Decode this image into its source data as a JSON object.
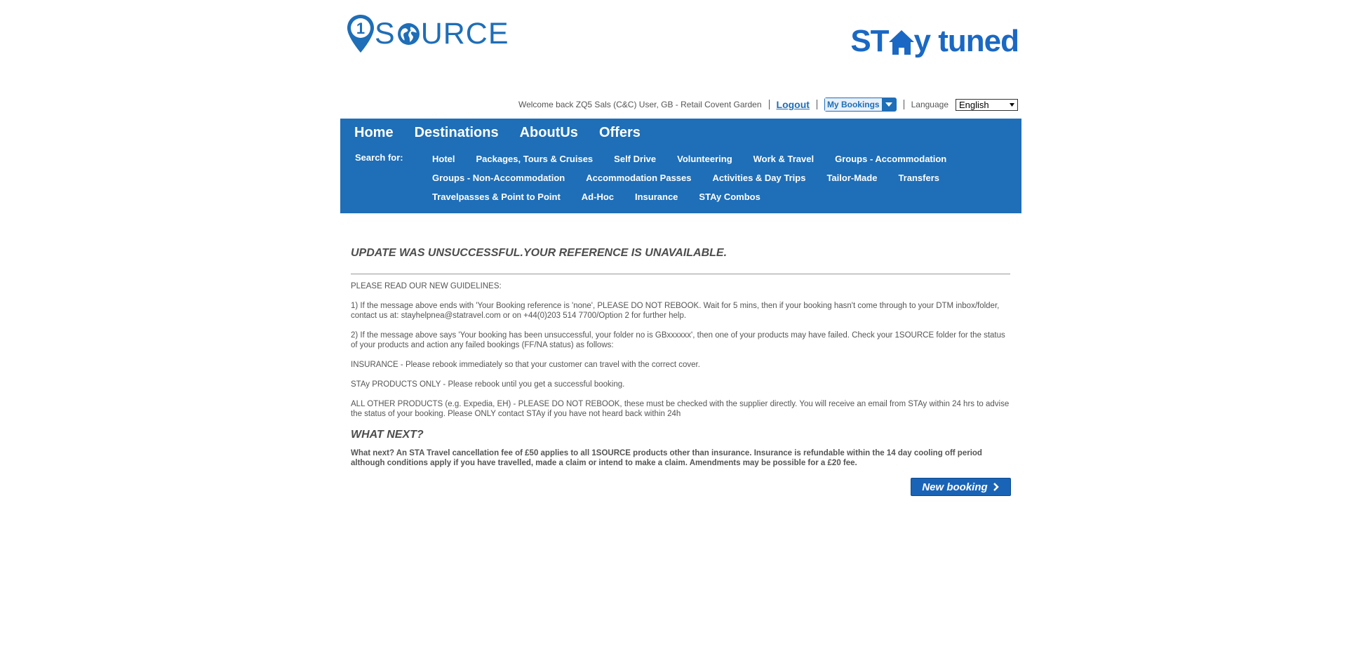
{
  "header": {
    "logo_left_text": "1SOURCE",
    "logo_right_text_start": "ST",
    "logo_right_text_end": "y tuned",
    "brand_color": "#1e6eb8"
  },
  "utility": {
    "welcome": "Welcome back ZQ5 Sals (C&C) User, GB - Retail Covent Garden",
    "logout": "Logout",
    "my_bookings": "My Bookings",
    "language_label": "Language",
    "language_value": "English"
  },
  "nav": {
    "main": [
      "Home",
      "Destinations",
      "AboutUs",
      "Offers"
    ],
    "search_label": "Search for:",
    "sub": [
      "Hotel",
      "Packages, Tours & Cruises",
      "Self Drive",
      "Volunteering",
      "Work & Travel",
      "Groups - Accommodation",
      "Groups - Non-Accommodation",
      "Accommodation Passes",
      "Activities & Day Trips",
      "Tailor-Made",
      "Transfers",
      "Travelpasses & Point to Point",
      "Ad-Hoc",
      "Insurance",
      "STAy Combos"
    ],
    "bg_color": "#1e6eb8"
  },
  "content": {
    "error_title": "UPDATE WAS UNSUCCESSFUL.YOUR REFERENCE IS UNAVAILABLE.",
    "paragraphs": [
      "PLEASE READ OUR NEW GUIDELINES:",
      "1) If the message above ends with 'Your Booking reference is 'none', PLEASE DO NOT REBOOK. Wait for 5 mins, then if your booking hasn't come through to your DTM inbox/folder, contact us at: stayhelpnea@statravel.com or on +44(0)203 514 7700/Option 2 for further help.",
      "2) If the message above says 'Your booking has been unsuccessful, your folder no is GBxxxxxx', then one of your products may have failed. Check your 1SOURCE folder for the status of your products and action any failed bookings (FF/NA status) as follows:",
      "INSURANCE - Please rebook immediately so that your customer can travel with the correct cover.",
      "STAy PRODUCTS ONLY - Please rebook until you get a successful booking.",
      "ALL OTHER PRODUCTS (e.g. Expedia, EH) - PLEASE DO NOT REBOOK, these must be checked with the supplier directly. You will receive an email from STAy within 24 hrs to advise the status of your booking. Please ONLY contact STAy if you have not heard back within 24h"
    ],
    "what_next_title": "WHAT NEXT?",
    "what_next_text": "What next? An STA Travel cancellation fee of £50 applies to all 1SOURCE products other than insurance. Insurance is refundable within the 14 day cooling off period although conditions apply if you have travelled, made a claim or intend to make a claim. Amendments may be possible for a £20 fee.",
    "new_booking_label": "New booking"
  }
}
